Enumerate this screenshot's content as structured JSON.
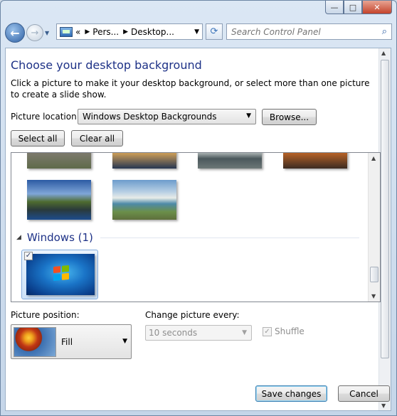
{
  "nav": {
    "breadcrumb_overflow": "«",
    "breadcrumb": [
      "Pers...",
      "Desktop..."
    ],
    "search_placeholder": "Search Control Panel"
  },
  "page": {
    "title": "Choose your desktop background",
    "description": "Click a picture to make it your desktop background, or select more than one picture to create a slide show.",
    "picture_location_label": "Picture location:",
    "picture_location_value": "Windows Desktop Backgrounds",
    "browse_label": "Browse...",
    "select_all_label": "Select all",
    "clear_all_label": "Clear all"
  },
  "gallery": {
    "group_name": "Windows (1)",
    "windows_item_checked": "✓"
  },
  "options": {
    "position_label": "Picture position:",
    "position_value": "Fill",
    "change_label": "Change picture every:",
    "change_value": "10 seconds",
    "shuffle_label": "Shuffle",
    "shuffle_checked": "✓"
  },
  "footer": {
    "save_label": "Save changes",
    "cancel_label": "Cancel"
  },
  "icons": {
    "minimize": "—",
    "maximize": "□",
    "close": "✕",
    "back": "←",
    "forward": "→",
    "refresh": "⟳",
    "search": "⌕",
    "dropdown": "▼"
  }
}
